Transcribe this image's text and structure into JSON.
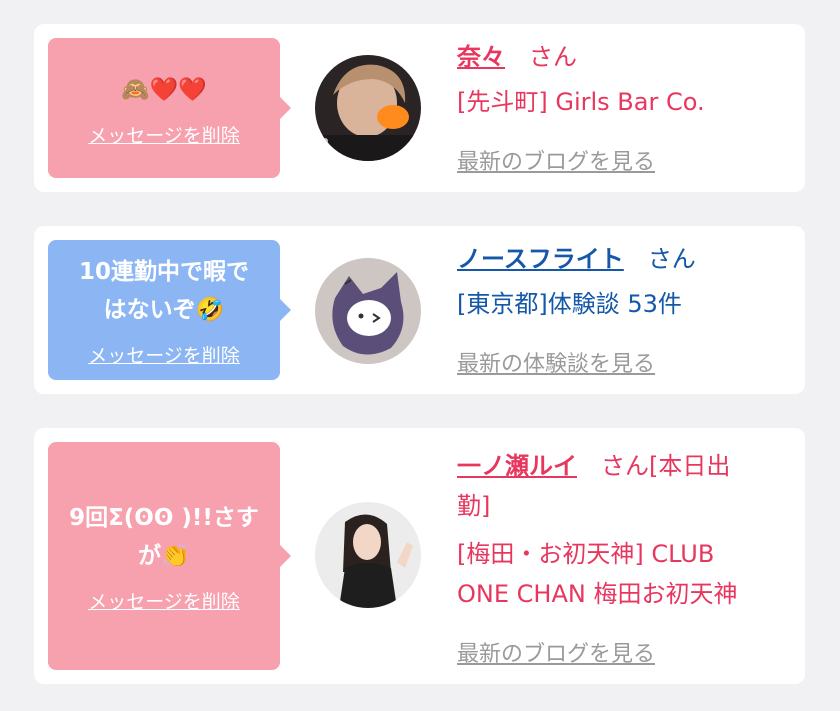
{
  "cards": [
    {
      "message": "🙈❤️❤️",
      "delete_label": "メッセージを削除",
      "name": "奈々",
      "suffix": "さん",
      "shop": "[先斗町] Girls Bar Co.",
      "more_label": "最新のブログを見る"
    },
    {
      "message_line1": "10連勤中で暇で",
      "message_line2": "はないぞ🤣",
      "delete_label": "メッセージを削除",
      "name": "ノースフライト",
      "suffix": "さん",
      "shop": "[東京都]体験談 53件",
      "more_label": "最新の体験談を見る"
    },
    {
      "message_line1": "9回Σ(ʘʘ )!!さす",
      "message_line2": "が👏",
      "delete_label": "メッセージを削除",
      "name": "一ノ瀬ルイ",
      "suffix_line1": "さん[本日出",
      "suffix_line2": "勤]",
      "shop_line1": "[梅田・お初天神] CLUB",
      "shop_line2": "ONE CHAN 梅田お初天神",
      "more_label": "最新のブログを見る"
    }
  ],
  "colors": {
    "pink_bubble": "#f7a0ae",
    "blue_bubble": "#8cb5f3",
    "pink_text": "#e8375f",
    "blue_text": "#1557a8",
    "muted": "#9a9a9a"
  }
}
